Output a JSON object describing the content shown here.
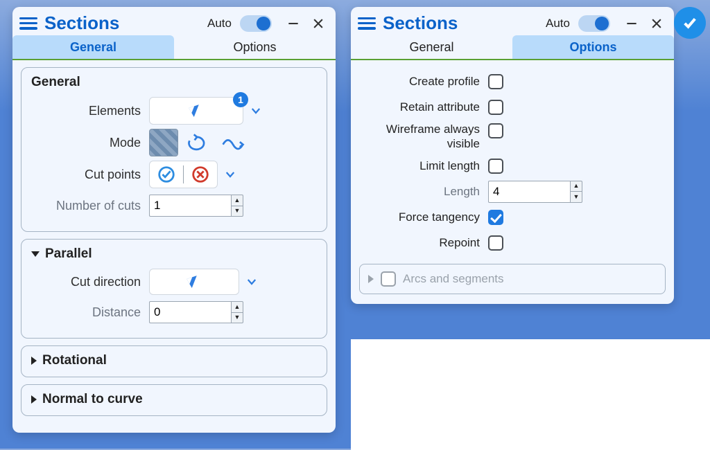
{
  "titlebar": {
    "title": "Sections",
    "auto_label": "Auto",
    "auto_on": true
  },
  "tabs": {
    "general": "General",
    "options": "Options"
  },
  "left": {
    "active_tab": "general",
    "general_group": {
      "heading": "General",
      "elements_label": "Elements",
      "elements_count": "1",
      "mode_label": "Mode",
      "cut_points_label": "Cut points",
      "num_cuts_label": "Number of cuts",
      "num_cuts_value": "1"
    },
    "parallel_group": {
      "heading": "Parallel",
      "expanded": true,
      "cut_direction_label": "Cut direction",
      "distance_label": "Distance",
      "distance_value": "0"
    },
    "rotational_group": {
      "heading": "Rotational",
      "expanded": false
    },
    "normal_group": {
      "heading": "Normal to curve",
      "expanded": false
    }
  },
  "right": {
    "active_tab": "options",
    "create_profile": {
      "label": "Create profile",
      "checked": false
    },
    "retain_attribute": {
      "label": "Retain attribute",
      "checked": false
    },
    "wireframe_visible": {
      "label": "Wireframe always visible",
      "checked": false
    },
    "limit_length": {
      "label": "Limit length",
      "checked": false
    },
    "length": {
      "label": "Length",
      "value": "4"
    },
    "force_tangency": {
      "label": "Force tangency",
      "checked": true
    },
    "repoint": {
      "label": "Repoint",
      "checked": false
    },
    "arcs_segments": {
      "label": "Arcs and segments",
      "checked": false
    }
  }
}
